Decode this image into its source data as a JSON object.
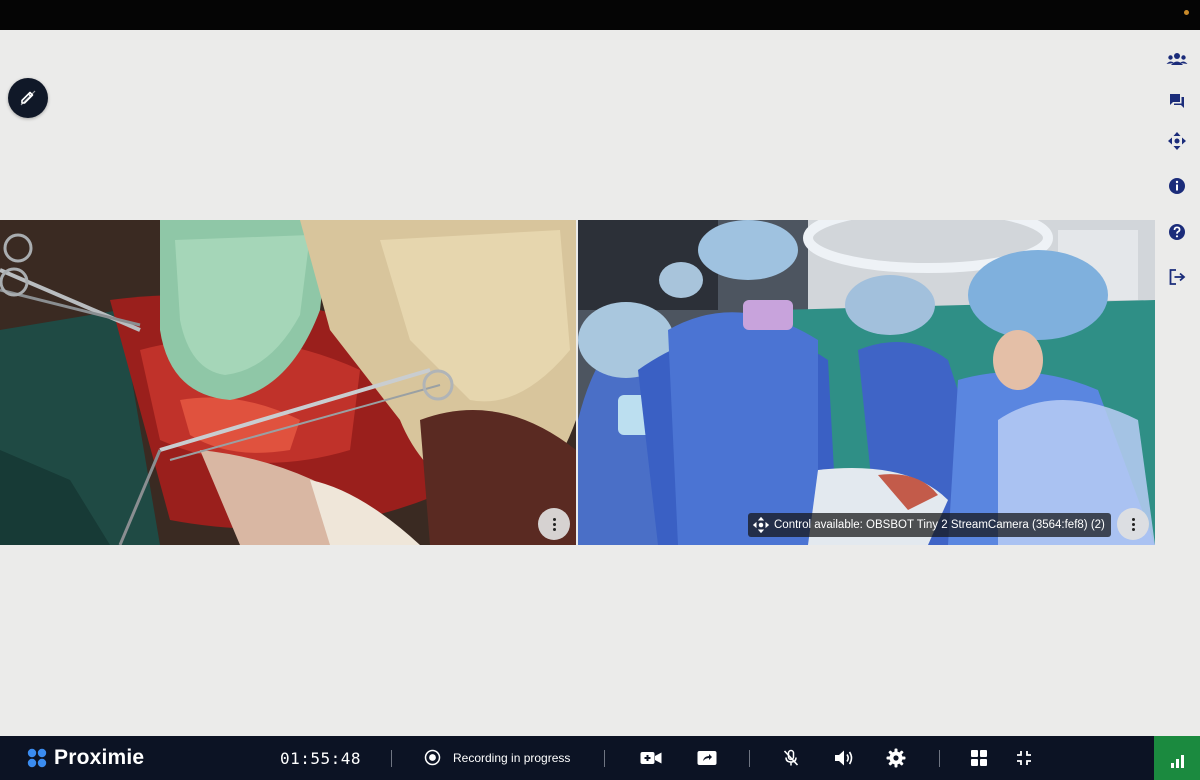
{
  "window": {
    "title": ""
  },
  "toolbar_left": {
    "annotate_icon": "pencil-edit-icon"
  },
  "right_rail": {
    "items": [
      {
        "name": "participants",
        "icon": "people-icon"
      },
      {
        "name": "chat",
        "icon": "chat-icon"
      },
      {
        "name": "camera-control",
        "icon": "move-arrows-icon"
      },
      {
        "name": "info",
        "icon": "info-icon"
      },
      {
        "name": "help",
        "icon": "help-icon"
      },
      {
        "name": "leave",
        "icon": "exit-icon"
      }
    ],
    "icon_color": "#1b2c7a"
  },
  "video_tiles": [
    {
      "name": "surgical-field-feed",
      "menu_icon": "more-vertical-icon"
    },
    {
      "name": "operating-room-feed",
      "menu_icon": "more-vertical-icon",
      "control_chip": {
        "icon": "move-arrows-icon",
        "text": "Control available: OBSBOT Tiny 2 StreamCamera (3564:fef8) (2)"
      }
    }
  ],
  "bottom_bar": {
    "brand": "Proximie",
    "timer": "01:55:48",
    "recording_label": "Recording in progress",
    "buttons": [
      {
        "name": "camera-button",
        "icon": "video-plus-icon"
      },
      {
        "name": "share-screen-button",
        "icon": "screen-share-icon"
      },
      {
        "name": "mute-button",
        "icon": "mic-off-icon"
      },
      {
        "name": "volume-button",
        "icon": "volume-icon"
      },
      {
        "name": "settings-button",
        "icon": "gear-icon"
      },
      {
        "name": "layout-button",
        "icon": "grid-icon"
      },
      {
        "name": "collapse-button",
        "icon": "collapse-icon"
      },
      {
        "name": "stats-button",
        "icon": "signal-bars-icon"
      }
    ],
    "colors": {
      "background": "#0c1324",
      "stats": "#1b8a3f",
      "brand_dots": "#3b8cf0"
    }
  }
}
